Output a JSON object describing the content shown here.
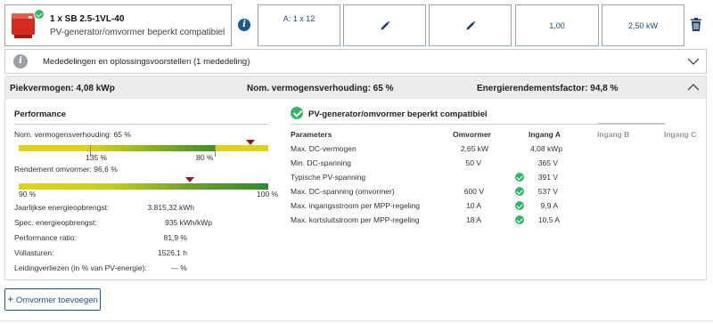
{
  "inverter": {
    "title": "1 x SB 2.5-1VL-40",
    "subtitle": "PV-generator/omvormer beperkt compatibiel",
    "info_icon_text": "i"
  },
  "config_cells": [
    {
      "label": "A: 1 x 12",
      "icon": ""
    },
    {
      "label": "",
      "icon": "pencil-icon"
    },
    {
      "label": "",
      "icon": "pencil-icon"
    },
    {
      "label": "1,00",
      "icon": ""
    },
    {
      "label": "2,50 kW",
      "icon": ""
    }
  ],
  "messages": {
    "icon_text": "i",
    "text": "Mededelingen en oplossingsvoorstellen (1 mededeling)"
  },
  "summary": {
    "peak_power": "Piekvermogen: 4,08 kWp",
    "power_ratio": "Nom. vermogensverhouding: 65 %",
    "energy_factor": "Energierendementsfactor: 94,8 %"
  },
  "performance": {
    "title": "Performance",
    "ratio_label": "Nom. vermogensverhouding: 65 %",
    "ratio_marker_fraction": 0.65,
    "ratio_scale_low": "135 %",
    "ratio_scale_high": "80 %",
    "efficiency_label": "Rendement omvormer: 96,6 %",
    "efficiency_marker": 96.6,
    "efficiency_scale_low": "90 %",
    "efficiency_scale_high": "100 %",
    "stats": [
      {
        "label": "Jaarlijkse energieopbrengst:",
        "value": "3.815,32 kWh"
      },
      {
        "label": "Spec. energieopbrengst:",
        "value": "935 kWh/kWp"
      },
      {
        "label": "Performance ratio:",
        "value": "81,9 %"
      },
      {
        "label": "Vollasturen:",
        "value": "1526,1 h"
      },
      {
        "label": "Leidingverliezen (in % van PV-energie):",
        "value": "--- %"
      }
    ]
  },
  "compat": {
    "title": "PV-generator/omvormer beperkt compatibiel",
    "headers": {
      "parameters": "Parameters",
      "omvormer": "Omvormer",
      "ingang_a": "Ingang A",
      "ingang_b": "Ingang B",
      "ingang_c": "Ingang C"
    },
    "rows": [
      {
        "param": "Max. DC-vermogen",
        "omvormer": "2,65 kW",
        "ingang_a": "4,08 kWp",
        "check": false
      },
      {
        "param": "Min. DC-spanning",
        "omvormer": "50 V",
        "ingang_a": "365 V",
        "check": false
      },
      {
        "param": "Typische PV-spanning",
        "omvormer": "",
        "ingang_a": "391 V",
        "check": true
      },
      {
        "param": "Max. DC-spanning (omvormer)",
        "omvormer": "600 V",
        "ingang_a": "537 V",
        "check": true
      },
      {
        "param": "Max. ingangsstroom per MPP-regeling",
        "omvormer": "10 A",
        "ingang_a": "9,9 A",
        "check": true
      },
      {
        "param": "Max. kortsluitstroom per MPP-regeling",
        "omvormer": "18 A",
        "ingang_a": "10,5 A",
        "check": true
      }
    ]
  },
  "add_button": {
    "plus": "+",
    "label": "Omvormer toevoegen"
  },
  "colors": {
    "brand_blue": "#1d5b8e",
    "ok_green": "#34b46a",
    "marker_red": "#8a1d23",
    "bar_yellow": "#e0d21a",
    "bar_green": "#3f8f2a"
  }
}
